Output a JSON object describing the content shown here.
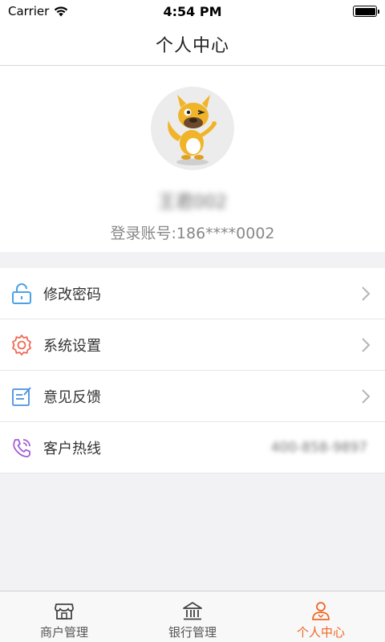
{
  "status_bar": {
    "carrier": "Carrier",
    "time": "4:54 PM"
  },
  "nav": {
    "title": "个人中心"
  },
  "profile": {
    "name": "王君002",
    "account_label": "登录账号:186****0002"
  },
  "menu": [
    {
      "label": "修改密码",
      "icon": "lock-icon",
      "color": "#4aa3e8"
    },
    {
      "label": "系统设置",
      "icon": "gear-icon",
      "color": "#ef6a56"
    },
    {
      "label": "意见反馈",
      "icon": "feedback-icon",
      "color": "#4a90e2"
    },
    {
      "label": "客户热线",
      "icon": "phone-icon",
      "color": "#a45fd6",
      "value": "400-858-9897"
    }
  ],
  "tabs": [
    {
      "label": "商户管理",
      "icon": "store-icon",
      "active": false
    },
    {
      "label": "银行管理",
      "icon": "bank-icon",
      "active": false
    },
    {
      "label": "个人中心",
      "icon": "person-icon",
      "active": true
    }
  ],
  "colors": {
    "accent": "#f26522",
    "background": "#f2f2f4"
  }
}
